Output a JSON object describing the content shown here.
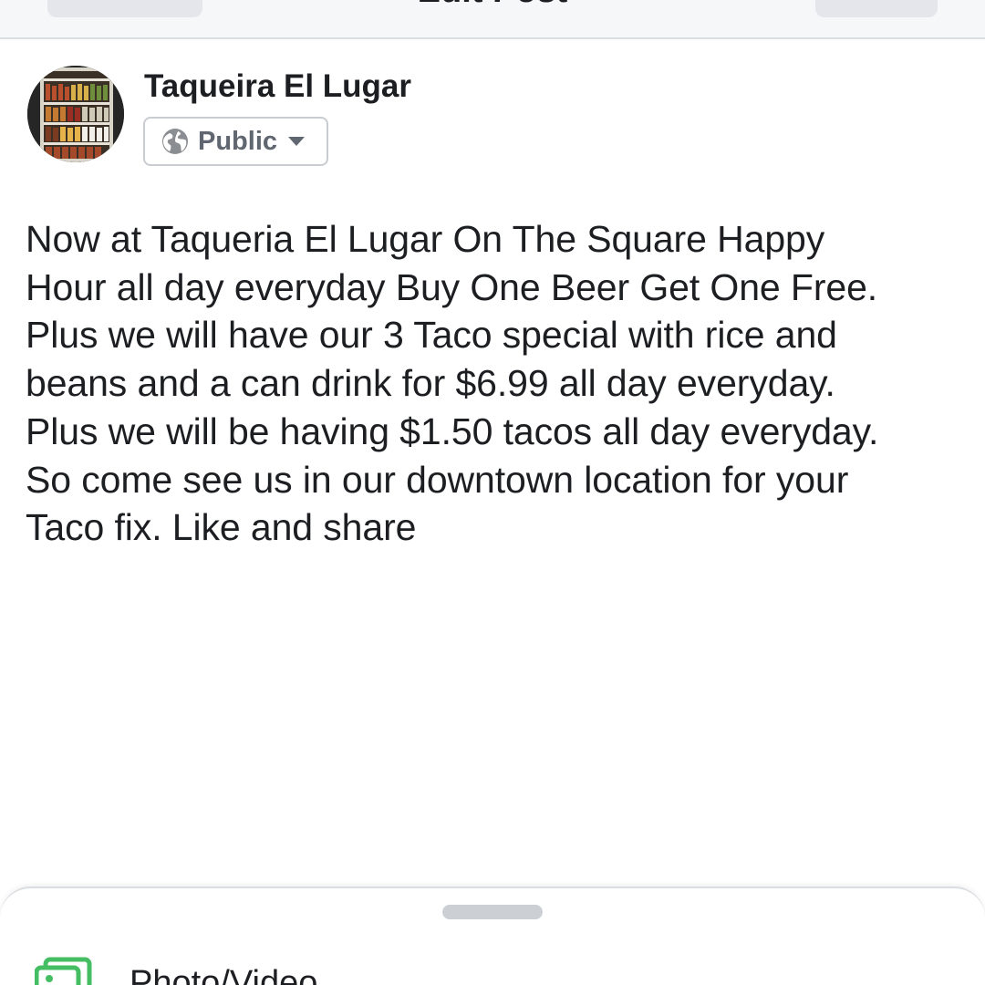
{
  "nav": {
    "title": "Edit Post"
  },
  "post": {
    "author": "Taqueira El Lugar",
    "privacy": "Public",
    "lines": [
      "Now at Taqueria El Lugar On The Square Happy",
      "Hour all day everyday Buy One Beer Get One Free.",
      "Plus we will have our 3 Taco special with rice and",
      "beans and a can drink for $6.99 all day everyday.",
      "Plus we will be having $1.50 tacos all day everyday.",
      "So come see us in our downtown location for your",
      "Taco fix. Like and share"
    ]
  },
  "sheet": {
    "photo_label": "Photo/Video"
  },
  "icons": {
    "privacy": "globe-icon",
    "dropdown": "caret-down-icon",
    "attachment": "photo-icon"
  },
  "colors": {
    "text": "#1c1e21",
    "secondary": "#606770",
    "border": "#c9ccd1",
    "photo_green": "#45bd62",
    "nav_bg": "#f6f7f9"
  }
}
